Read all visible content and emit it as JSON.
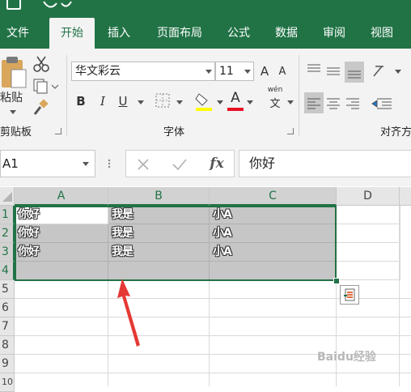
{
  "tabs": [
    "文件",
    "开始",
    "插入",
    "页面布局",
    "公式",
    "数据",
    "审阅",
    "视图"
  ],
  "ribbon": {
    "paste_label": "粘贴",
    "clipboard_group": "剪贴板",
    "font_name": "华文彩云",
    "font_size": "11",
    "grow_font": "A",
    "shrink_font": "A",
    "bold": "B",
    "italic": "I",
    "underline": "U",
    "font_color_letter": "A",
    "phonetic_top": "wén",
    "phonetic_char": "文",
    "font_group": "字体",
    "align_group": "对齐方"
  },
  "formula_bar": {
    "name_box": "A1",
    "fx_label": "fx",
    "formula": "你好"
  },
  "grid": {
    "columns": [
      "A",
      "B",
      "C",
      "D"
    ],
    "rows": [
      "1",
      "2",
      "3",
      "4",
      "5",
      "6",
      "7",
      "8",
      "9",
      "10"
    ],
    "cells": [
      [
        "你好",
        "我是",
        "小A"
      ],
      [
        "你好",
        "我是",
        "小A"
      ],
      [
        "你好",
        "我是",
        "小A"
      ]
    ]
  },
  "watermark": "Baidu经验",
  "colors": {
    "accent": "#217346",
    "arrow": "#e53935",
    "font_color_bar": "#e81123",
    "highlight_bar": "#ffff00"
  }
}
